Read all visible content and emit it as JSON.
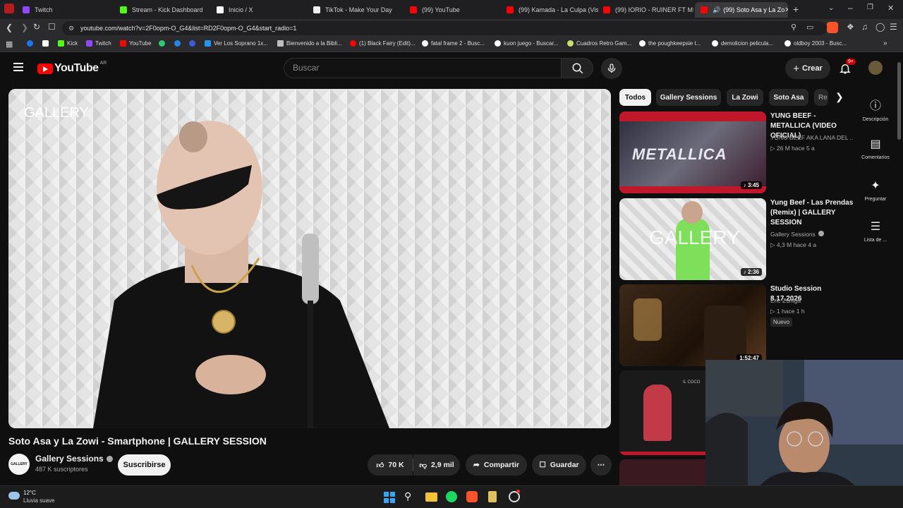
{
  "browser": {
    "tabs": [
      {
        "label": "Twitch",
        "color": "#9146ff"
      },
      {
        "label": "Stream - Kick Dashboard",
        "color": "#53fc18"
      },
      {
        "label": "Inicio / X",
        "color": "#ffffff"
      },
      {
        "label": "TikTok - Make Your Day",
        "color": "#ffffff"
      },
      {
        "label": "(99) YouTube",
        "color": "#ff0000"
      },
      {
        "label": "(99) Kamada - La Culpa (Visu",
        "color": "#ff0000"
      },
      {
        "label": "(99) IORIO - RUINER FT MIR",
        "color": "#ff0000"
      },
      {
        "label": "(99) Soto Asa y La Zo",
        "color": "#ff0000"
      }
    ],
    "url": "youtube.com/watch?v=2F0opm-O_G4&list=RD2F0opm-O_G4&start_radio=1",
    "bookmarks": [
      {
        "label": "",
        "color": "#1877f2"
      },
      {
        "label": "",
        "color": "#ffffff"
      },
      {
        "label": "Kick",
        "color": "#53fc18"
      },
      {
        "label": "Twitch",
        "color": "#9146ff"
      },
      {
        "label": "YouTube",
        "color": "#ff0000"
      },
      {
        "label": "",
        "color": "#2ecc71"
      },
      {
        "label": "",
        "color": "#1e88e5"
      },
      {
        "label": "",
        "color": "#3b5bdb"
      },
      {
        "label": "Ver Los Soprano 1x...",
        "color": "#2196f3"
      },
      {
        "label": "Bienvenido a la Bibli...",
        "color": "#bdbdbd"
      },
      {
        "label": "(1) Black Fairy (Edit)...",
        "color": "#ff0000"
      },
      {
        "label": "fatal frame 2 - Busc...",
        "color": "#ffffff"
      },
      {
        "label": "kuon juego - Buscar...",
        "color": "#ffffff"
      },
      {
        "label": "Cuadros Retro Gam...",
        "color": "#c8e06c"
      },
      {
        "label": "the poughkeepsie t...",
        "color": "#ffffff"
      },
      {
        "label": "demolicion pelicula...",
        "color": "#ffffff"
      },
      {
        "label": "oldboy 2003 - Busc...",
        "color": "#ffffff"
      }
    ]
  },
  "header": {
    "logo": "YouTube",
    "region": "AR",
    "search_placeholder": "Buscar",
    "create_label": "Crear",
    "notif_badge": "9+"
  },
  "video": {
    "overlay_text": "GALLERY",
    "title": "Soto Asa y La Zowi - Smartphone | GALLERY SESSION",
    "channel": "Gallery Sessions",
    "channel_avatar_text": "GALLERY",
    "subscribers": "487 K suscriptores",
    "subscribe_label": "Suscribirse",
    "likes": "70 K",
    "dislikes": "2,9 mil",
    "share_label": "Compartir",
    "save_label": "Guardar"
  },
  "filters": [
    "Todos",
    "Gallery Sessions",
    "La Zowi",
    "Soto Asa",
    "Re"
  ],
  "recommendations": [
    {
      "title": "YUNG BEEF - METALLICA (VIDEO OFICIAL)",
      "channel": "YUNG BEEF AKA LANA DEL ...",
      "stats": "26 M   hace 5 a",
      "duration": "3:45",
      "thumb_text": "METALLICA"
    },
    {
      "title": "Yung Beef - Las Prendas (Remix) | GALLERY SESSION",
      "channel": "Gallery Sessions",
      "stats": "4,3 M   hace 4 a",
      "duration": "2:36",
      "thumb_text": "GALLERY"
    },
    {
      "title": "Studio Session 8.17.2026",
      "channel": "Eric Zuniga",
      "stats": "1   hace 1 h",
      "badge": "Nuevo",
      "duration": "1:52:47"
    }
  ],
  "thumb4_text": "IL COCO",
  "rail": [
    "Descripción",
    "Comentarios",
    "Preguntar",
    "Lista de ..."
  ],
  "taskbar": {
    "temp": "12°C",
    "weather": "Lluvia suave"
  }
}
